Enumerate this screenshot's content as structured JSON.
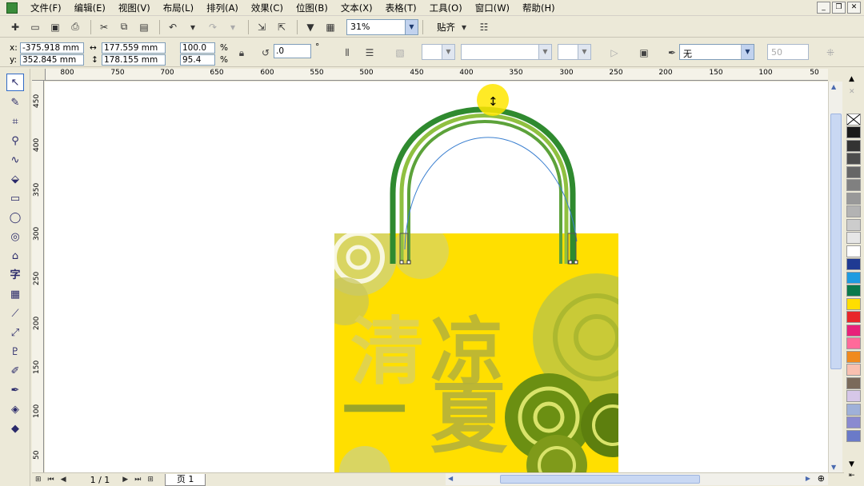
{
  "menu": [
    "文件(F)",
    "编辑(E)",
    "视图(V)",
    "布局(L)",
    "排列(A)",
    "效果(C)",
    "位图(B)",
    "文本(X)",
    "表格(T)",
    "工具(O)",
    "窗口(W)",
    "帮助(H)"
  ],
  "window_controls": [
    "_",
    "❐",
    "✕"
  ],
  "toolbar": {
    "zoom": "31%",
    "snap_label": "贴齐"
  },
  "propbar": {
    "x_label": "x:",
    "x_value": "-375.918 mm",
    "y_label": "y:",
    "y_value": "352.845 mm",
    "width": "177.559 mm",
    "height": "178.155 mm",
    "scale_w": "100.0",
    "scale_h": "95.4",
    "percent": "%",
    "rotation": ".0",
    "degree": "°",
    "outline": "无",
    "outline_size": "50"
  },
  "rulers": {
    "horizontal": [
      "800",
      "750",
      "700",
      "650",
      "600",
      "550",
      "500",
      "450",
      "400",
      "350",
      "300",
      "250",
      "200",
      "150",
      "100",
      "50"
    ],
    "vertical": [
      "450",
      "400",
      "350",
      "300",
      "250",
      "200",
      "150",
      "100",
      "50"
    ]
  },
  "artwork": {
    "char_1": "清",
    "char_2": "凉",
    "char_3": "一",
    "char_4": "夏"
  },
  "palette_colors": [
    "#1a1a1a",
    "#333333",
    "#4d4d4d",
    "#666666",
    "#808080",
    "#999999",
    "#b3b3b3",
    "#cccccc",
    "#e6e6e6",
    "#ffffff",
    "#1f3a93",
    "#1e9be0",
    "#0b7a4b",
    "#ffde00",
    "#e8262a",
    "#e8207a",
    "#ff6a9a",
    "#f08a1e",
    "#f9c0b0",
    "#7a6a5a",
    "#d6c7e8",
    "#9fb1d9",
    "#8a8ad0",
    "#6a7ac8"
  ],
  "bottom": {
    "page_count": "1 / 1",
    "page_tab": "页 1"
  }
}
